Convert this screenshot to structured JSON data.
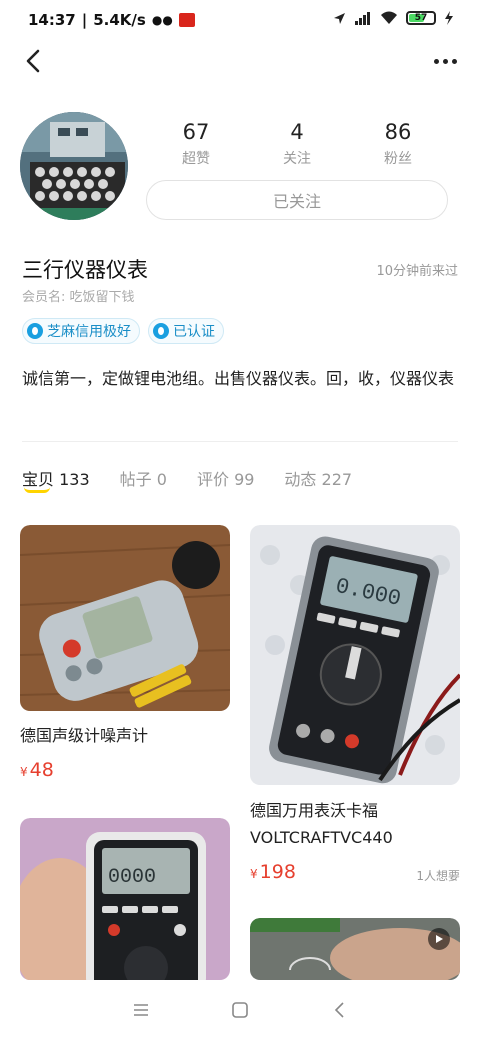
{
  "status_bar": {
    "time": "14:37",
    "speed": "5.4K/s",
    "battery": "57",
    "colors": {
      "battery_fill": "#4cd964"
    }
  },
  "nav": {
    "back_icon": "chevron-left-icon",
    "more_icon": "more-dots-icon"
  },
  "profile": {
    "stats": [
      {
        "value": "67",
        "label": "超赞"
      },
      {
        "value": "4",
        "label": "关注"
      },
      {
        "value": "86",
        "label": "粉丝"
      }
    ],
    "follow_button": "已关注",
    "name": "三行仪器仪表",
    "last_visit": "10分钟前来过",
    "member": "会员名: 吃饭留下钱",
    "badges": [
      {
        "label": "芝麻信用极好",
        "icon": "sesame-credit-icon"
      },
      {
        "label": "已认证",
        "icon": "verified-icon"
      }
    ],
    "description": "诚信第一，定做锂电池组。出售仪器仪表。回，收，仪器仪表"
  },
  "tabs": [
    {
      "name": "宝贝",
      "count": "133",
      "active": true
    },
    {
      "name": "帖子",
      "count": "0"
    },
    {
      "name": "评价",
      "count": "99"
    },
    {
      "name": "动态",
      "count": "227"
    }
  ],
  "items": [
    {
      "title": "德国声级计噪声计",
      "price_symbol": "¥",
      "price": "48",
      "wants": ""
    },
    {
      "title": "德国万用表沃卡福VOLTCRAFTVC440",
      "price_symbol": "¥",
      "price": "198",
      "wants": "1人想要"
    }
  ],
  "colors": {
    "accent_yellow": "#ffd400",
    "price_red": "#e63f2e",
    "badge_blue": "#1a8ec7"
  }
}
